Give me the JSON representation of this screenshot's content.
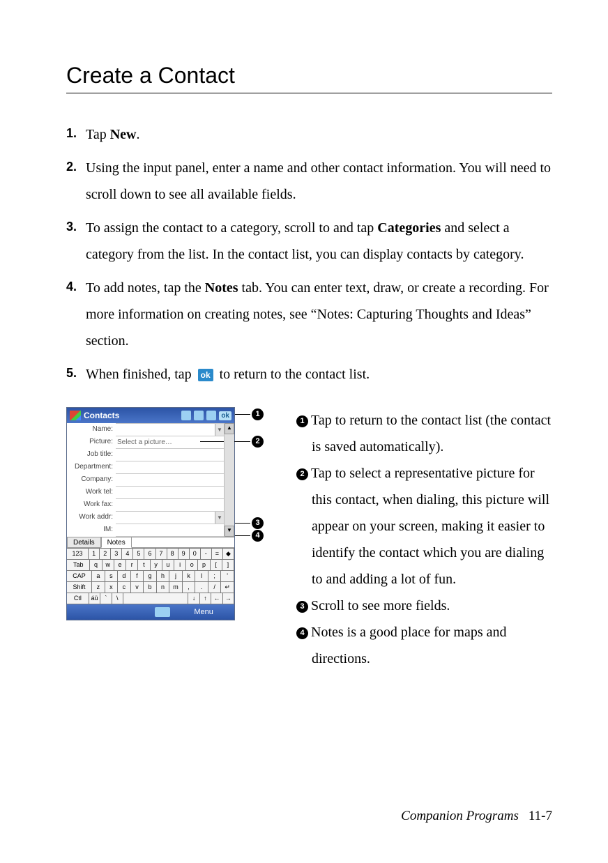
{
  "title": "Create a Contact",
  "steps": [
    {
      "num": "1.",
      "pre": "Tap ",
      "bold": "New",
      "post": "."
    },
    {
      "num": "2.",
      "text": "Using the input panel, enter a name and other contact information. You will need to scroll down to see all available fields."
    },
    {
      "num": "3.",
      "pre": "To assign the contact to a category, scroll to and tap ",
      "bold": "Categories",
      "post": " and select a category from the list. In the contact list, you can display contacts by category."
    },
    {
      "num": "4.",
      "pre": "To add notes, tap the ",
      "bold": "Notes",
      "post": " tab. You can enter text, draw, or create a recording. For more information on creating notes, see “Notes: Capturing Thoughts and Ideas” section."
    },
    {
      "num": "5.",
      "pre": "When finished, tap ",
      "icon": "ok",
      "post": " to return to the contact list."
    }
  ],
  "screenshot": {
    "title": "Contacts",
    "ok_label": "ok",
    "fields": {
      "name": "Name:",
      "picture": "Picture:",
      "picture_value": "Select a picture…",
      "job_title": "Job title:",
      "department": "Department:",
      "company": "Company:",
      "work_tel": "Work tel:",
      "work_fax": "Work fax:",
      "work_addr": "Work addr:",
      "im": "IM:"
    },
    "tabs": {
      "details": "Details",
      "notes": "Notes"
    },
    "keyboard": {
      "row1": [
        "123",
        "1",
        "2",
        "3",
        "4",
        "5",
        "6",
        "7",
        "8",
        "9",
        "0",
        "-",
        "=",
        "◆"
      ],
      "row2": [
        "Tab",
        "q",
        "w",
        "e",
        "r",
        "t",
        "y",
        "u",
        "i",
        "o",
        "p",
        "[",
        "]"
      ],
      "row3": [
        "CAP",
        "a",
        "s",
        "d",
        "f",
        "g",
        "h",
        "j",
        "k",
        "l",
        ";",
        "'"
      ],
      "row4": [
        "Shift",
        "z",
        "x",
        "c",
        "v",
        "b",
        "n",
        "m",
        ",",
        ".",
        "/",
        "↵"
      ],
      "row5": [
        "Ctl",
        "áü",
        "`",
        "\\",
        " ",
        "↓",
        "↑",
        "←",
        "→"
      ]
    },
    "menu": "Menu"
  },
  "callouts": {
    "c1": "❶",
    "c2": "❷",
    "c3": "❸",
    "c4": "❹"
  },
  "legend": {
    "l1": "Tap to return to the contact list (the contact is saved automatically).",
    "l2": "Tap to select a representative picture for this contact, when dialing, this picture will appear on your screen, making it easier to identify the contact which you are dialing to and adding a lot of fun.",
    "l3": "Scroll to see more fields.",
    "l4": "Notes is a good place for maps and directions."
  },
  "footer": {
    "text": "Companion Programs",
    "page": "11-7"
  }
}
